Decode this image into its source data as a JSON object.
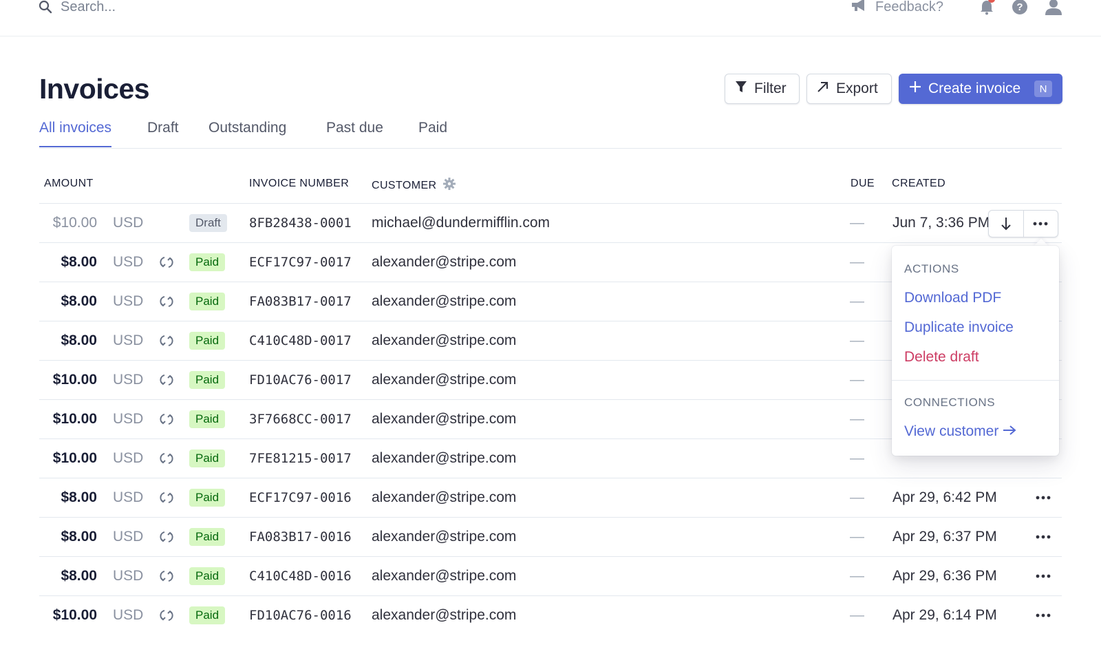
{
  "topbar": {
    "search_placeholder": "Search...",
    "feedback_label": "Feedback?"
  },
  "header": {
    "title": "Invoices",
    "filter_label": "Filter",
    "export_label": "Export",
    "create_label": "Create invoice",
    "create_shortcut": "N"
  },
  "tabs": [
    "All invoices",
    "Draft",
    "Outstanding",
    "Past due",
    "Paid"
  ],
  "columns": {
    "amount": "AMOUNT",
    "invoice_number": "INVOICE NUMBER",
    "customer": "CUSTOMER",
    "due": "DUE",
    "created": "CREATED"
  },
  "rows": [
    {
      "amount": "$10.00",
      "currency": "USD",
      "status": "Draft",
      "number": "8FB28438-0001",
      "customer": "michael@dundermifflin.com",
      "due": "—",
      "created": "Jun 7, 3:36 PM"
    },
    {
      "amount": "$8.00",
      "currency": "USD",
      "status": "Paid",
      "number": "ECF17C97-0017",
      "customer": "alexander@stripe.com",
      "due": "—",
      "created": ""
    },
    {
      "amount": "$8.00",
      "currency": "USD",
      "status": "Paid",
      "number": "FA083B17-0017",
      "customer": "alexander@stripe.com",
      "due": "—",
      "created": ""
    },
    {
      "amount": "$8.00",
      "currency": "USD",
      "status": "Paid",
      "number": "C410C48D-0017",
      "customer": "alexander@stripe.com",
      "due": "—",
      "created": ""
    },
    {
      "amount": "$10.00",
      "currency": "USD",
      "status": "Paid",
      "number": "FD10AC76-0017",
      "customer": "alexander@stripe.com",
      "due": "—",
      "created": ""
    },
    {
      "amount": "$10.00",
      "currency": "USD",
      "status": "Paid",
      "number": "3F7668CC-0017",
      "customer": "alexander@stripe.com",
      "due": "—",
      "created": ""
    },
    {
      "amount": "$10.00",
      "currency": "USD",
      "status": "Paid",
      "number": "7FE81215-0017",
      "customer": "alexander@stripe.com",
      "due": "—",
      "created": ""
    },
    {
      "amount": "$8.00",
      "currency": "USD",
      "status": "Paid",
      "number": "ECF17C97-0016",
      "customer": "alexander@stripe.com",
      "due": "—",
      "created": "Apr 29, 6:42 PM"
    },
    {
      "amount": "$8.00",
      "currency": "USD",
      "status": "Paid",
      "number": "FA083B17-0016",
      "customer": "alexander@stripe.com",
      "due": "—",
      "created": "Apr 29, 6:37 PM"
    },
    {
      "amount": "$8.00",
      "currency": "USD",
      "status": "Paid",
      "number": "C410C48D-0016",
      "customer": "alexander@stripe.com",
      "due": "—",
      "created": "Apr 29, 6:36 PM"
    },
    {
      "amount": "$10.00",
      "currency": "USD",
      "status": "Paid",
      "number": "FD10AC76-0016",
      "customer": "alexander@stripe.com",
      "due": "—",
      "created": "Apr 29, 6:14 PM"
    }
  ],
  "menu": {
    "actions_header": "ACTIONS",
    "download_pdf": "Download PDF",
    "duplicate_invoice": "Duplicate invoice",
    "delete_draft": "Delete draft",
    "connections_header": "CONNECTIONS",
    "view_customer": "View customer"
  },
  "colors": {
    "accent": "#5469d4",
    "danger": "#cd3d64",
    "paid_bg": "#d7f7c2",
    "paid_text": "#05690d",
    "draft_bg": "#e3e8ee",
    "notification_dot": "#e25950"
  },
  "icons": [
    "search-icon",
    "megaphone-icon",
    "bell-icon",
    "help-icon",
    "user-icon",
    "filter-icon",
    "export-arrow-icon",
    "plus-icon",
    "gear-icon",
    "recurring-icon",
    "download-icon",
    "more-icon",
    "arrow-right-icon"
  ]
}
